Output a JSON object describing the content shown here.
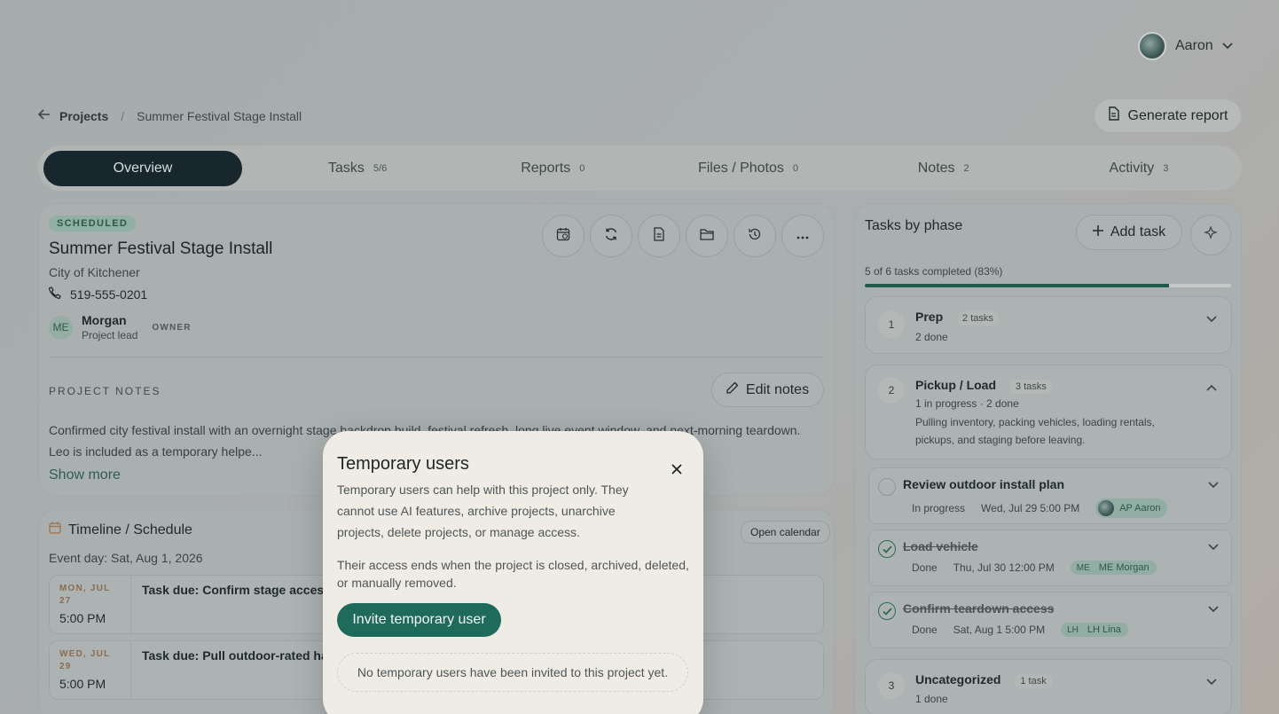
{
  "user": {
    "name": "Aaron"
  },
  "breadcrumb": {
    "root": "Projects",
    "separator": "/",
    "current": "Summer Festival Stage Install"
  },
  "header": {
    "generate_report": "Generate report"
  },
  "tabs": [
    {
      "label": "Overview",
      "count": ""
    },
    {
      "label": "Tasks",
      "count": "5/6"
    },
    {
      "label": "Reports",
      "count": "0"
    },
    {
      "label": "Files / Photos",
      "count": "0"
    },
    {
      "label": "Notes",
      "count": "2"
    },
    {
      "label": "Activity",
      "count": "3"
    }
  ],
  "project": {
    "status": "SCHEDULED",
    "title": "Summer Festival Stage Install",
    "client": "City of Kitchener",
    "phone": "519-555-0201",
    "owner": {
      "initials": "ME",
      "name": "Morgan",
      "role": "Project lead",
      "badge": "OWNER"
    },
    "notes_label": "PROJECT NOTES",
    "edit_notes": "Edit notes",
    "notes_line1": "Confirmed city festival install with an overnight stage backdrop build, festival refresh, long live event window, and next-morning teardown.",
    "notes_line2": "Leo is included as a temporary helpe...",
    "show_more": "Show more"
  },
  "timeline": {
    "title": "Timeline / Schedule",
    "open_calendar": "Open calendar",
    "event_day": "Event day: Sat, Aug 1, 2026",
    "rows": [
      {
        "date": "MON, JUL 27",
        "time": "5:00 PM",
        "task": "Task due: Confirm stage access time"
      },
      {
        "date": "WED, JUL 29",
        "time": "5:00 PM",
        "task": "Task due: Pull outdoor-rated hardware"
      }
    ]
  },
  "phases": {
    "title": "Tasks by phase",
    "add_task": "Add task",
    "progress_text": "5 of 6 tasks completed (83%)",
    "progress": 0.83,
    "groups": [
      {
        "num": "1",
        "name": "Prep",
        "count": "2 tasks",
        "sub": "2 done"
      },
      {
        "num": "2",
        "name": "Pickup / Load",
        "count": "3 tasks",
        "sub": "1 in progress · 2 done",
        "desc": "Pulling inventory, packing vehicles, loading rentals, pickups, and staging before leaving."
      },
      {
        "num": "3",
        "name": "Uncategorized",
        "count": "1 task",
        "sub": "1 done"
      }
    ],
    "tasks": [
      {
        "name": "Review outdoor install plan",
        "status": "In progress",
        "due": "Wed, Jul 29 5:00 PM",
        "assignee_initials": "AP",
        "assignee": "AP Aaron"
      },
      {
        "name": "Load vehicle",
        "status": "Done",
        "due": "Thu, Jul 30 12:00 PM",
        "assignee_initials": "ME",
        "assignee": "ME Morgan"
      },
      {
        "name": "Confirm teardown access",
        "status": "Done",
        "due": "Sat, Aug 1 5:00 PM",
        "assignee_initials": "LH",
        "assignee": "LH Lina"
      }
    ]
  },
  "modal": {
    "title": "Temporary users",
    "description": "Temporary users can help with this project only. They cannot use AI features, archive projects, unarchive projects, delete projects, or manage access.",
    "access_note": "Their access ends when the project is closed, archived, deleted, or manually removed.",
    "invite_button": "Invite temporary user",
    "empty_state": "No temporary users have been invited to this project yet."
  }
}
